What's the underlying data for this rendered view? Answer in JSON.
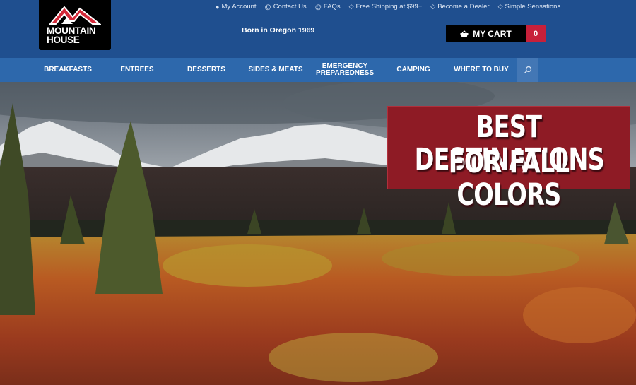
{
  "brand": {
    "logo_line1": "MOUNTAIN",
    "logo_line2": "HOUSE",
    "tagline": "Born in Oregon 1969",
    "colors": {
      "header_bg": "#1f4f8f",
      "nav_bg": "#2d68ac",
      "accent_red": "#c8203a",
      "banner_red": "#8e1b25"
    }
  },
  "utility_nav": [
    {
      "label": "My Account",
      "icon": "user-icon"
    },
    {
      "label": "Contact Us",
      "icon": "at-icon"
    },
    {
      "label": "FAQs",
      "icon": "at-icon"
    },
    {
      "label": "Free Shipping at $99+",
      "icon": "tag-icon"
    },
    {
      "label": "Become a Dealer",
      "icon": "tag-icon"
    },
    {
      "label": "Simple Sensations",
      "icon": "tag-icon"
    }
  ],
  "cart": {
    "label": "MY CART",
    "count": "0",
    "icon": "basket-icon"
  },
  "main_nav": [
    {
      "label": "BREAKFASTS"
    },
    {
      "label": "ENTREES"
    },
    {
      "label": "DESSERTS"
    },
    {
      "label": "SIDES & MEATS"
    },
    {
      "label": "EMERGENCY PREPAREDNESS",
      "line1": "EMERGENCY",
      "line2": "PREPAREDNESS"
    },
    {
      "label": "CAMPING"
    },
    {
      "label": "WHERE TO BUY"
    }
  ],
  "search": {
    "icon": "search-icon"
  },
  "hero": {
    "headline_line1": "BEST DESTINATIONS",
    "headline_line2": "FOR FALL COLORS",
    "image_alt": "Snow-capped mountains above autumn tundra with spruce trees"
  }
}
